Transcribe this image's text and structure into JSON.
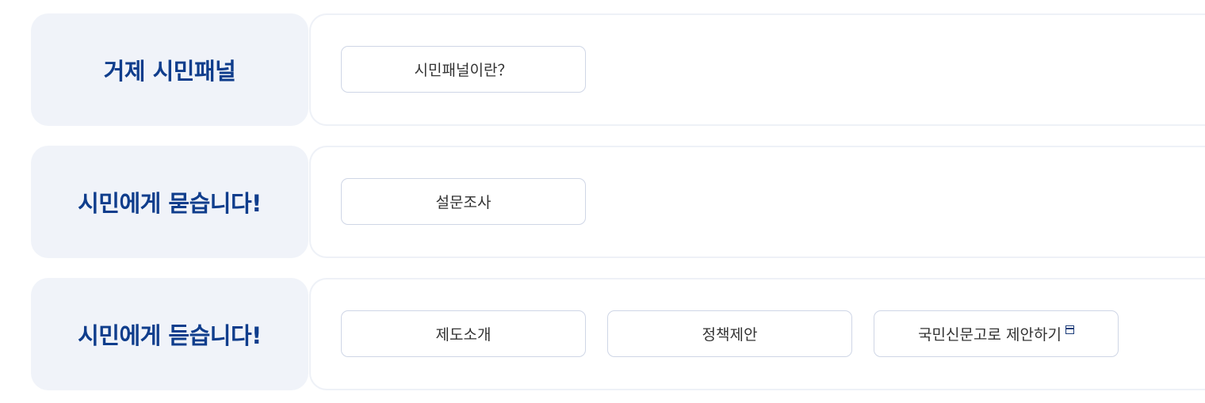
{
  "sections": [
    {
      "title": "거제 시민패널",
      "links": [
        {
          "label": "시민패널이란？"
        }
      ]
    },
    {
      "title": "시민에게 묻습니다!",
      "links": [
        {
          "label": "설문조사"
        }
      ]
    },
    {
      "title": "시민에게 듣습니다!",
      "links": [
        {
          "label": "제도소개"
        },
        {
          "label": "정책제안"
        },
        {
          "label": "국민신문고로 제안하기",
          "icon": "new-window-icon"
        }
      ]
    }
  ],
  "colors": {
    "title_text": "#0f3d8c",
    "title_bg": "#f0f3f9",
    "button_border": "#cfd6e6",
    "button_text": "#333333"
  }
}
